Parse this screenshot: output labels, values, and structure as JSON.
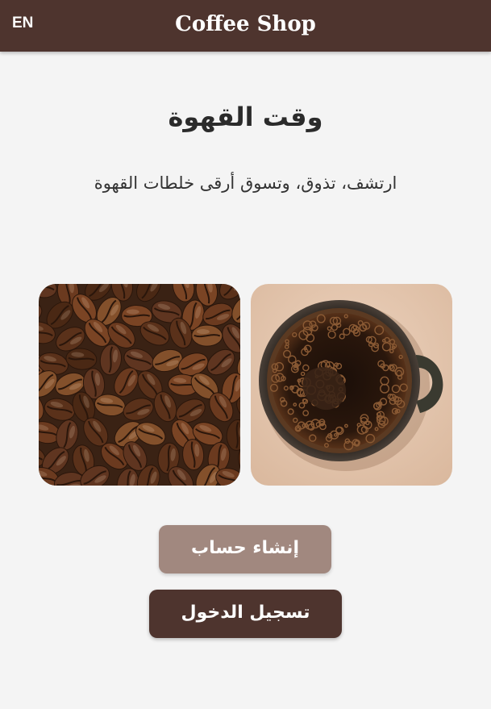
{
  "app_bar": {
    "title": "Coffee Shop",
    "language_toggle": "EN",
    "background": "#4e342e"
  },
  "hero": {
    "title": "وقت القهوة",
    "tagline": "ارتشف، تذوق، وتسوق أرقى خلطات القهوة"
  },
  "images": [
    {
      "name": "coffee-beans-photo"
    },
    {
      "name": "coffee-cup-photo"
    }
  ],
  "actions": {
    "signup_label": "إنشاء حساب",
    "signup_color": "#a1887f",
    "login_label": "تسجيل الدخول",
    "login_color": "#4e342e"
  }
}
